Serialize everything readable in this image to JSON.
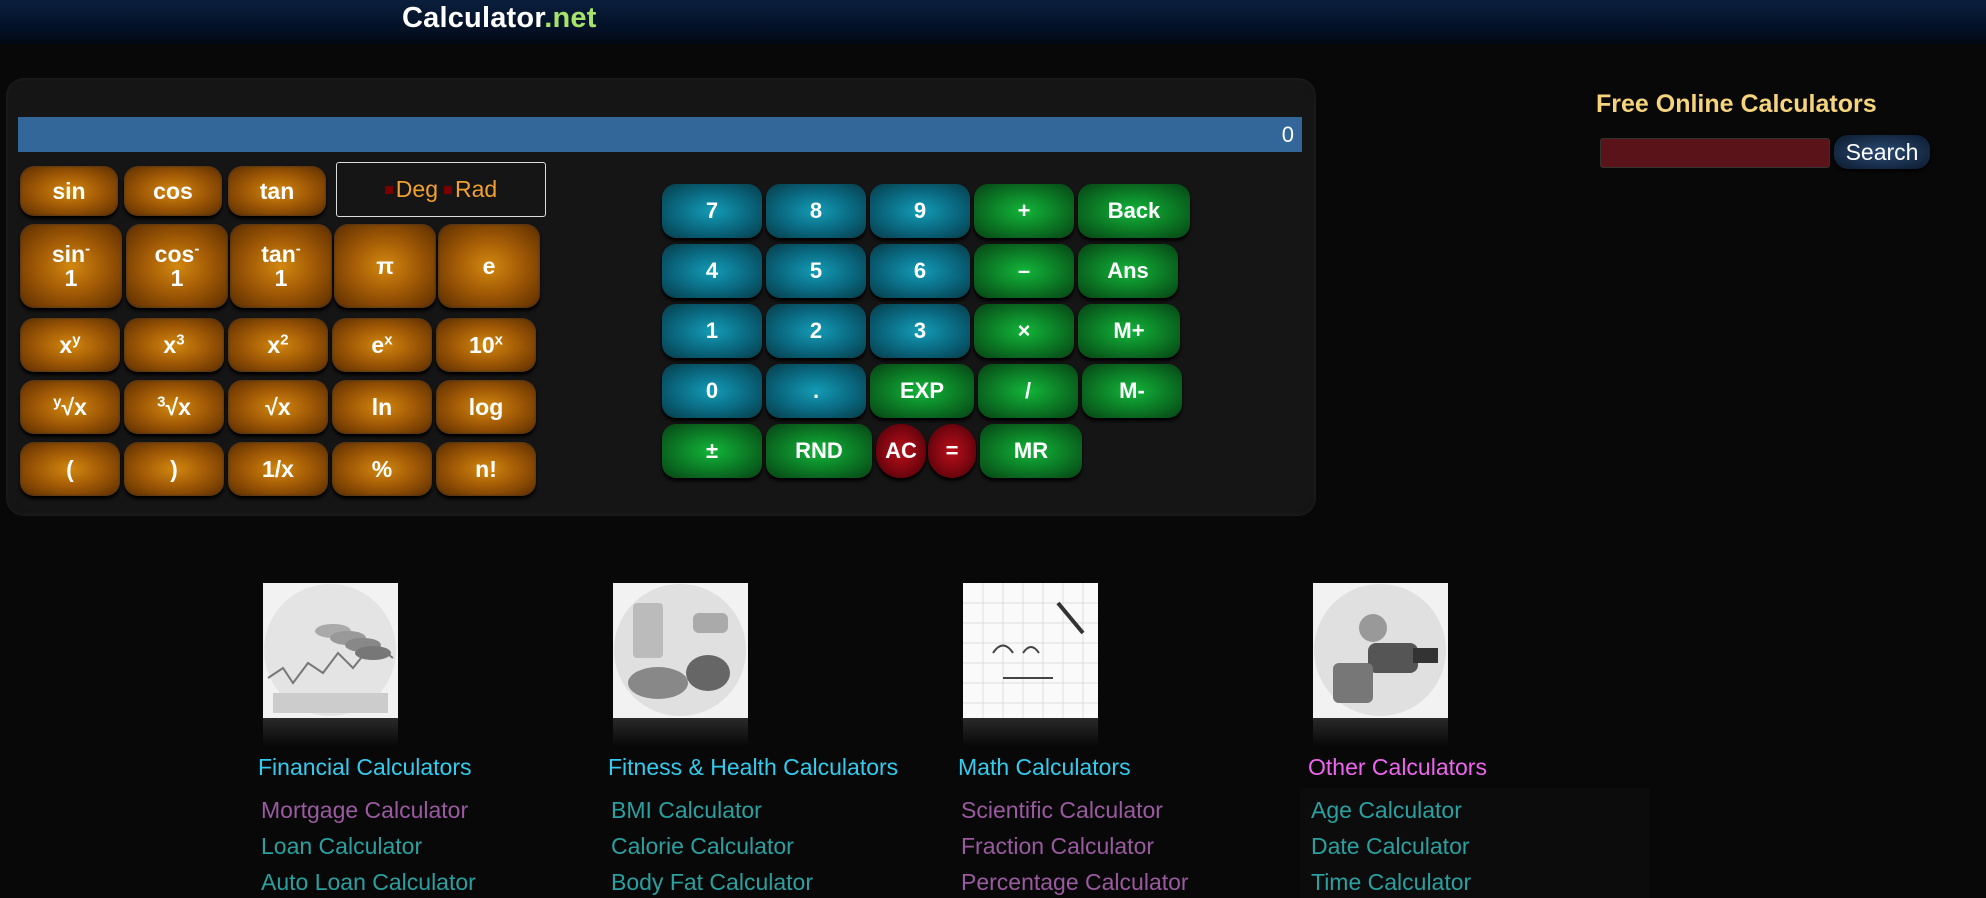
{
  "header": {
    "logo_main": "Calculator",
    "logo_suffix": ".net"
  },
  "display": {
    "value": "0"
  },
  "mode": {
    "deg_label": "Deg",
    "rad_label": "Rad"
  },
  "sci_buttons": {
    "sin": "sin",
    "cos": "cos",
    "tan": "tan",
    "asin_base": "sin",
    "asin_sup": "-",
    "asin_sub": "1",
    "acos_base": "cos",
    "acos_sup": "-",
    "acos_sub": "1",
    "atan_base": "tan",
    "atan_sup": "-",
    "atan_sub": "1",
    "pi": "π",
    "e": "e",
    "xy_base": "x",
    "xy_sup": "y",
    "x3_base": "x",
    "x3_sup": "3",
    "x2_base": "x",
    "x2_sup": "2",
    "ex_base": "e",
    "ex_sup": "x",
    "tenx_base": "10",
    "tenx_sup": "x",
    "yroot_sup": "y",
    "yroot_base": "√x",
    "cbrt_sup": "3",
    "cbrt_base": "√x",
    "sqrt": "√x",
    "ln": "ln",
    "log": "log",
    "lparen": "(",
    "rparen": ")",
    "recip": "1/x",
    "percent": "%",
    "fact": "n!"
  },
  "num_buttons": {
    "n7": "7",
    "n8": "8",
    "n9": "9",
    "plus": "+",
    "back": "Back",
    "n4": "4",
    "n5": "5",
    "n6": "6",
    "minus": "–",
    "ans": "Ans",
    "n1": "1",
    "n2": "2",
    "n3": "3",
    "times": "×",
    "mplus": "M+",
    "n0": "0",
    "dot": ".",
    "exp": "EXP",
    "divide": "/",
    "mminus": "M-",
    "plusminus": "±",
    "rnd": "RND",
    "ac": "AC",
    "equals": "=",
    "mr": "MR"
  },
  "sidebar": {
    "title": "Free Online Calculators",
    "search_label": "Search"
  },
  "categories": [
    {
      "title": "Financial Calculators",
      "color": "#33ccee",
      "links": [
        "Mortgage Calculator",
        "Loan Calculator",
        "Auto Loan Calculator"
      ],
      "link_colors": [
        "#9a5aa0",
        "#2aa0a0",
        "#2aa0a0"
      ]
    },
    {
      "title": "Fitness & Health Calculators",
      "color": "#33ccee",
      "links": [
        "BMI Calculator",
        "Calorie Calculator",
        "Body Fat Calculator"
      ],
      "link_colors": [
        "#2aa0a0",
        "#2aa0a0",
        "#2aa0a0"
      ]
    },
    {
      "title": "Math Calculators",
      "color": "#33ccee",
      "links": [
        "Scientific Calculator",
        "Fraction Calculator",
        "Percentage Calculator"
      ],
      "link_colors": [
        "#9a5aa0",
        "#9a5aa0",
        "#9a5aa0"
      ]
    },
    {
      "title": "Other Calculators",
      "color": "#ee66ee",
      "links": [
        "Age Calculator",
        "Date Calculator",
        "Time Calculator"
      ],
      "link_colors": [
        "#2aa0a0",
        "#2aa0a0",
        "#2aa0a0"
      ]
    }
  ]
}
